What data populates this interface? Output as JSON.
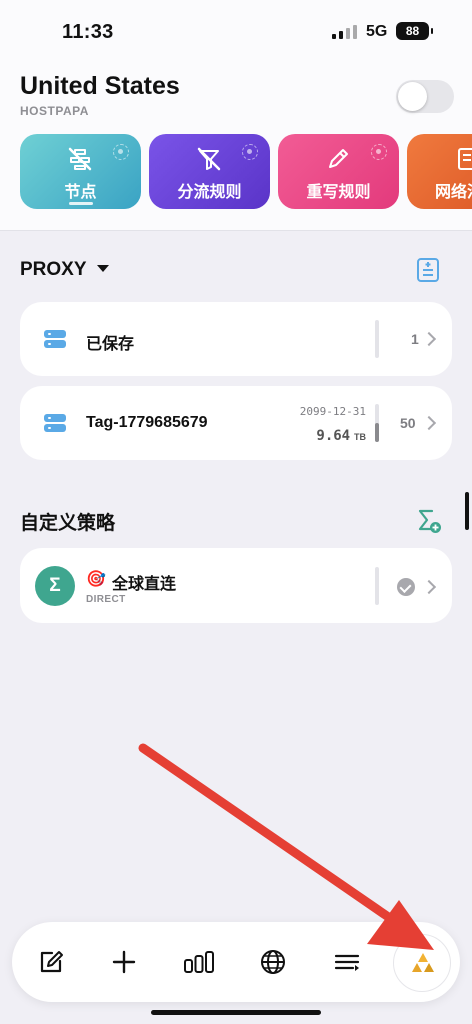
{
  "status_bar": {
    "time": "11:33",
    "network": "5G",
    "battery": "88"
  },
  "header": {
    "title": "United States",
    "subtitle": "HOSTPAPA",
    "toggle_on": false
  },
  "tiles": [
    {
      "label": "节点",
      "icon": "node-off-icon",
      "color_start": "#6fd0d4",
      "color_end": "#3aa3c4",
      "selected": true
    },
    {
      "label": "分流规则",
      "icon": "rule-off-icon",
      "color_start": "#7a54e8",
      "color_end": "#5a34c8"
    },
    {
      "label": "重写规则",
      "icon": "pencil-icon",
      "color_start": "#f25c95",
      "color_end": "#e33a7c"
    },
    {
      "label": "网络活",
      "icon": "document-icon",
      "color_start": "#f07a3e",
      "color_end": "#e05f2b"
    }
  ],
  "proxy_section": {
    "title": "PROXY",
    "rows": [
      {
        "label": "已保存",
        "count": "1",
        "icon": "server-icon"
      },
      {
        "label": "Tag-1779685679",
        "date": "2099-12-31",
        "traffic_value": "9.64",
        "traffic_unit": "TB",
        "usage": 0.5,
        "count": "50",
        "icon": "server-icon"
      }
    ]
  },
  "custom_section": {
    "title": "自定义策略",
    "rows": [
      {
        "avatar": "Σ",
        "emoji": "🎯",
        "name": "全球直连",
        "type": "DIRECT",
        "selected": true
      }
    ]
  },
  "tabbar": {
    "items": [
      "edit-icon",
      "plus-icon",
      "chart-icon",
      "globe-icon",
      "list-icon"
    ],
    "fab": "aperture-logo-icon"
  },
  "annotation": {
    "color": "#e53f34"
  },
  "colors": {
    "accent_teal": "#3fa68f",
    "page_bg": "#f0eff5"
  }
}
